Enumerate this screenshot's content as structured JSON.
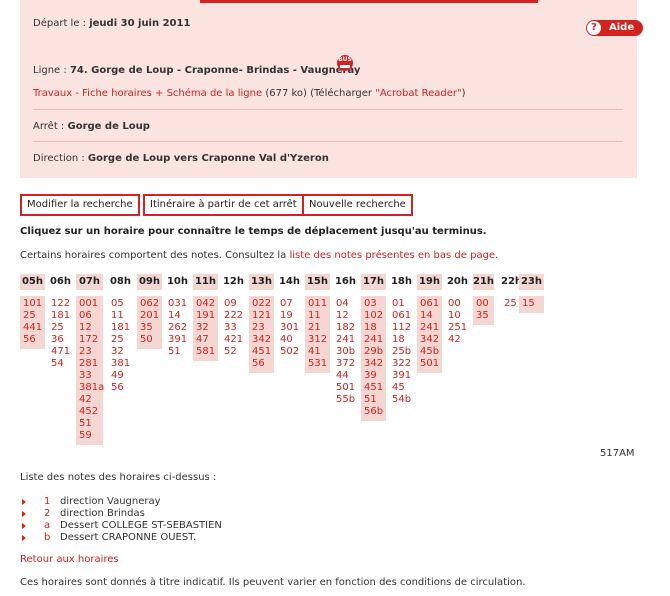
{
  "header": {
    "depart_label": "Départ le :",
    "depart_date": "jeudi 30 juin 2011",
    "help_label": "Aide",
    "line_label": "Ligne :",
    "line_value": "74. Gorge de Loup - Craponne- Brindas - Vaugneray",
    "bus_badge": "BUS",
    "works_link": "Travaux - Fiche horaires + Schéma de la ligne",
    "file_size": "(677 ko)",
    "download_prefix": "(Télécharger ",
    "download_link": "\"Acrobat Reader\"",
    "download_suffix": ")",
    "stop_label": "Arrêt :",
    "stop_value": "Gorge de Loup",
    "direction_label": "Direction :",
    "direction_value": "Gorge de Loup vers Craponne Val d'Yzeron"
  },
  "actions": {
    "modify": "Modifier la recherche",
    "itinerary": "Itinéraire à partir de cet arrêt",
    "new_search": "Nouvelle recherche"
  },
  "instruction": "Cliquez sur un horaire pour connaître le temps de déplacement jusqu'au terminus.",
  "notes_intro": "Certains horaires comportent des notes. Consultez la ",
  "notes_intro_link": "liste des notes présentes en bas de page",
  "notes_intro_end": ".",
  "hours": [
    "05h",
    "06h",
    "07h",
    "08h",
    "09h",
    "10h",
    "11h",
    "12h",
    "13h",
    "14h",
    "15h",
    "16h",
    "17h",
    "18h",
    "19h",
    "20h",
    "21h",
    "22h",
    "23h"
  ],
  "minutes": [
    [
      "101",
      "25",
      "441",
      "56"
    ],
    [
      "122",
      "181",
      "25",
      "36",
      "471",
      "54"
    ],
    [
      "001",
      "06",
      "12",
      "172",
      "23",
      "281",
      "33",
      "381a",
      "42",
      "452",
      "51",
      "59"
    ],
    [
      "05",
      "11",
      "181",
      "25",
      "32",
      "381",
      "49",
      "56"
    ],
    [
      "062",
      "201",
      "35",
      "50"
    ],
    [
      "031",
      "14",
      "262",
      "391",
      "51"
    ],
    [
      "042",
      "191",
      "32",
      "47",
      "581"
    ],
    [
      "09",
      "222",
      "33",
      "421",
      "52"
    ],
    [
      "022",
      "121",
      "23",
      "342",
      "451",
      "56"
    ],
    [
      "07",
      "19",
      "301",
      "40",
      "502"
    ],
    [
      "011",
      "11",
      "21",
      "312",
      "41",
      "531"
    ],
    [
      "04",
      "12",
      "182",
      "241",
      "30b",
      "372",
      "44",
      "501",
      "55b"
    ],
    [
      "03",
      "102",
      "18",
      "241",
      "29b",
      "342",
      "39",
      "451",
      "51",
      "56b"
    ],
    [
      "01",
      "061",
      "112",
      "18",
      "25b",
      "322",
      "391",
      "45",
      "54b"
    ],
    [
      "061",
      "14",
      "241",
      "342",
      "45b",
      "501"
    ],
    [
      "00",
      "10",
      "251",
      "42"
    ],
    [
      "00",
      "35"
    ],
    [
      "25"
    ],
    [
      "15"
    ]
  ],
  "code": "517AM",
  "notes_title": "Liste des notes des horaires ci-dessus :",
  "notes": [
    {
      "key": "1",
      "text": "direction Vaugneray"
    },
    {
      "key": "2",
      "text": "direction Brindas"
    },
    {
      "key": "a",
      "text": "Dessert COLLEGE ST-SEBASTIEN"
    },
    {
      "key": "b",
      "text": "Dessert CRAPONNE OUEST."
    }
  ],
  "back_link": "Retour aux horaires",
  "disclaimer": "Ces horaires sont donnés à titre indicatif. Ils peuvent varier en fonction des conditions de circulation.",
  "colors": {
    "accent": "#d3221f",
    "panel": "#fbe3e0",
    "cell": "#f4d7d3"
  }
}
